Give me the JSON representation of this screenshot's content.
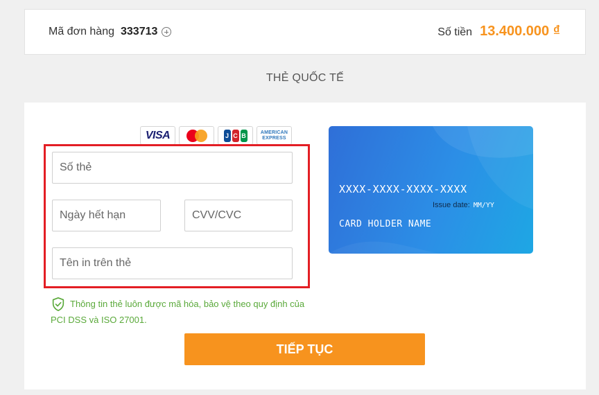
{
  "order": {
    "label": "Mã đơn hàng",
    "id": "333713",
    "amount_label": "Số tiền",
    "amount": "13.400.000 ₫"
  },
  "section_title": "THẺ QUỐC TẾ",
  "brands": [
    {
      "name": "visa",
      "text": "VISA",
      "color": "#1a1f71"
    },
    {
      "name": "mastercard",
      "colors": [
        "#eb001b",
        "#f79e1b"
      ]
    },
    {
      "name": "jcb",
      "letters": [
        "J",
        "C",
        "B"
      ],
      "colors": [
        "#0e4c96",
        "#d2232a",
        "#00954a"
      ]
    },
    {
      "name": "amex",
      "lines": [
        "AMERICAN",
        "EXPRESS"
      ],
      "color": "#2e77bb"
    }
  ],
  "form": {
    "card_number_placeholder": "Số thẻ",
    "card_number_value": "",
    "expiry_placeholder": "Ngày hết hạn",
    "expiry_value": "",
    "cvv_placeholder": "CVV/CVC",
    "cvv_value": "",
    "holder_placeholder": "Tên in trên thẻ",
    "holder_value": "",
    "highlight_color": "#e31e24"
  },
  "secure_note": "Thông tin thẻ luôn được mã hóa, bảo vệ theo quy định của PCI DSS và ISO 27001.",
  "submit_label": "TIẾP TỤC",
  "card_preview": {
    "number": "XXXX-XXXX-XXXX-XXXX",
    "issue_label": "Issue date:",
    "issue_value": "MM/YY",
    "holder": "CARD HOLDER NAME"
  },
  "colors": {
    "accent": "#f7931e",
    "secure_green": "#5aa93a",
    "card_blue": "#2c8ee6"
  },
  "icons": {
    "order_expand": "plus-circle-icon",
    "secure": "shield-check-icon"
  }
}
